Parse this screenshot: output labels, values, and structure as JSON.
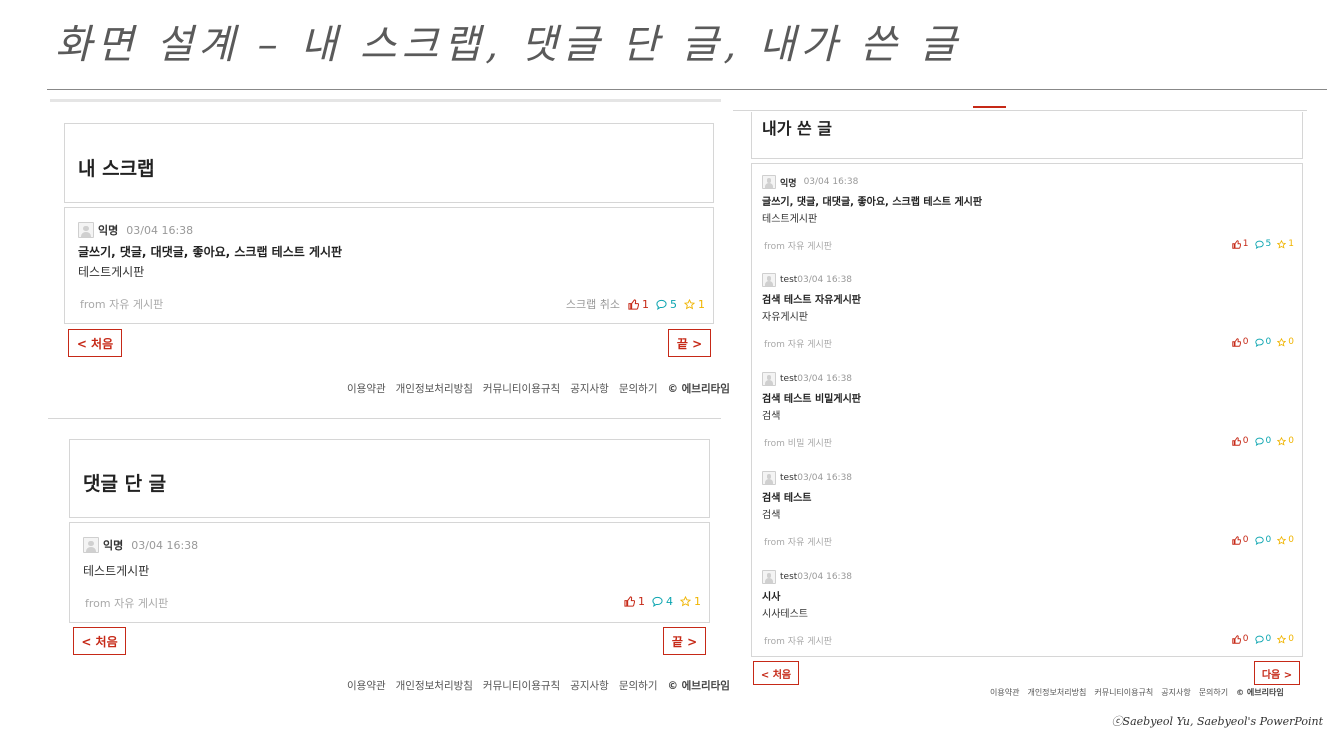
{
  "slide_title": "화면 설계 – 내 스크랩, 댓글 단 글, 내가 쓴 글",
  "credit": "ⓒSaebyeol Yu, Saebyeol's PowerPoint",
  "colors": {
    "accent": "#c62917",
    "comment": "#0ca5b0",
    "scrap": "#f0b400",
    "border": "#d6d6d6"
  },
  "icons": {
    "vote": "thumbs-up-icon",
    "comment": "speech-bubble-icon",
    "scrap": "star-icon",
    "avatar": "user-avatar-icon"
  },
  "scrap_panel": {
    "title": "내 스크랩",
    "posts": [
      {
        "author": "익명",
        "time": "03/04 16:38",
        "title": "글쓰기, 댓글, 대댓글, 좋아요, 스크랩 테스트 게시판",
        "body": "테스트게시판",
        "from": "from 자유 게시판",
        "scrap_cancel": "스크랩 취소",
        "votes": "1",
        "comments": "5",
        "scraps": "1"
      }
    ],
    "first_button": "< 처음",
    "last_button": "끝 >"
  },
  "comment_panel": {
    "title": "댓글 단 글",
    "posts": [
      {
        "author": "익명",
        "time": "03/04 16:38",
        "body": "테스트게시판",
        "from": "from 자유 게시판",
        "votes": "1",
        "comments": "4",
        "scraps": "1"
      }
    ],
    "first_button": "< 처음",
    "last_button": "끝 >"
  },
  "my_posts_panel": {
    "title": "내가 쓴 글",
    "posts": [
      {
        "author": "익명",
        "time": "03/04 16:38",
        "title": "글쓰기, 댓글, 대댓글, 좋아요, 스크랩 테스트 게시판",
        "body": "테스트게시판",
        "from": "from 자유 게시판",
        "votes": "1",
        "comments": "5",
        "scraps": "1"
      },
      {
        "author": "test",
        "time": "03/04 16:38",
        "title": "검색 테스트 자유게시판",
        "body": "자유게시판",
        "from": "from 자유 게시판",
        "votes": "0",
        "comments": "0",
        "scraps": "0"
      },
      {
        "author": "test",
        "time": "03/04 16:38",
        "title": "검색 테스트 비밀게시판",
        "body": "검색",
        "from": "from 비밀 게시판",
        "votes": "0",
        "comments": "0",
        "scraps": "0"
      },
      {
        "author": "test",
        "time": "03/04 16:38",
        "title": "검색 테스트",
        "body": "검색",
        "from": "from 자유 게시판",
        "votes": "0",
        "comments": "0",
        "scraps": "0"
      },
      {
        "author": "test",
        "time": "03/04 16:38",
        "title": "시사",
        "body": "시사테스트",
        "from": "from 자유 게시판",
        "votes": "0",
        "comments": "0",
        "scraps": "0"
      }
    ],
    "first_button": "< 처음",
    "next_button": "다음 >"
  },
  "footer": {
    "links": [
      "이용약관",
      "개인정보처리방침",
      "커뮤니티이용규칙",
      "공지사항",
      "문의하기"
    ],
    "copyright": "© 에브리타임"
  }
}
